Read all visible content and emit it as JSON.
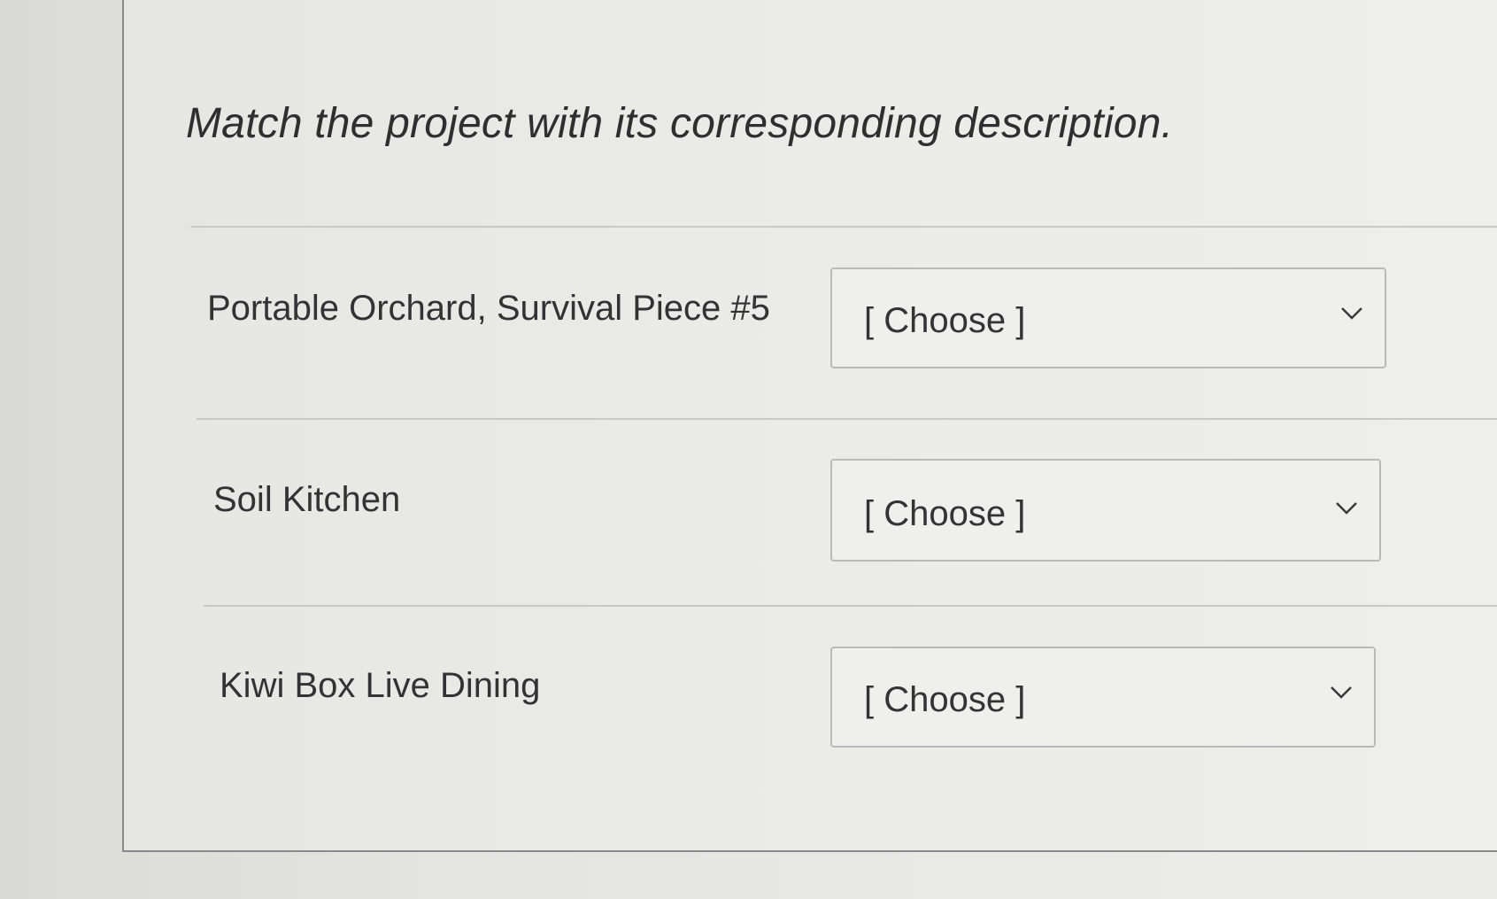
{
  "question": {
    "prompt": "Match the project with its corresponding description."
  },
  "matches": [
    {
      "label": "Portable Orchard, Survival Piece #5",
      "selected": "[ Choose ]"
    },
    {
      "label": "Soil Kitchen",
      "selected": "[ Choose ]"
    },
    {
      "label": "Kiwi Box Live Dining",
      "selected": "[ Choose ]"
    }
  ],
  "icons": {
    "dropdown": "chevron-down-icon"
  }
}
